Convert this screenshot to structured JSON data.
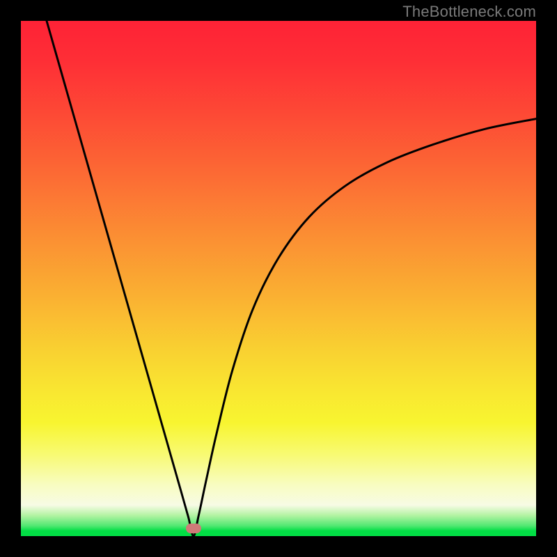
{
  "watermark": "TheBottleneck.com",
  "chart_data": {
    "type": "line",
    "title": "",
    "xlabel": "",
    "ylabel": "",
    "xlim": [
      0,
      1
    ],
    "ylim": [
      0,
      1
    ],
    "minimum_x": 0.335,
    "marker": {
      "x": 0.335,
      "y": 0.985,
      "color": "#cf7a78"
    },
    "series": [
      {
        "name": "curve",
        "x": [
          0.05,
          0.08,
          0.11,
          0.14,
          0.17,
          0.2,
          0.23,
          0.26,
          0.29,
          0.31,
          0.325,
          0.335,
          0.345,
          0.36,
          0.38,
          0.41,
          0.45,
          0.5,
          0.56,
          0.63,
          0.71,
          0.8,
          0.9,
          1.0
        ],
        "y": [
          1.0,
          0.895,
          0.79,
          0.685,
          0.58,
          0.475,
          0.37,
          0.265,
          0.16,
          0.09,
          0.037,
          0.0,
          0.04,
          0.11,
          0.2,
          0.32,
          0.44,
          0.54,
          0.62,
          0.68,
          0.725,
          0.76,
          0.79,
          0.81
        ]
      }
    ],
    "gradient_stops": [
      {
        "pos": 0.0,
        "color": "#fe2236"
      },
      {
        "pos": 0.5,
        "color": "#fab232"
      },
      {
        "pos": 0.8,
        "color": "#f8f530"
      },
      {
        "pos": 0.95,
        "color": "#b2f3a2"
      },
      {
        "pos": 1.0,
        "color": "#02de45"
      }
    ]
  }
}
